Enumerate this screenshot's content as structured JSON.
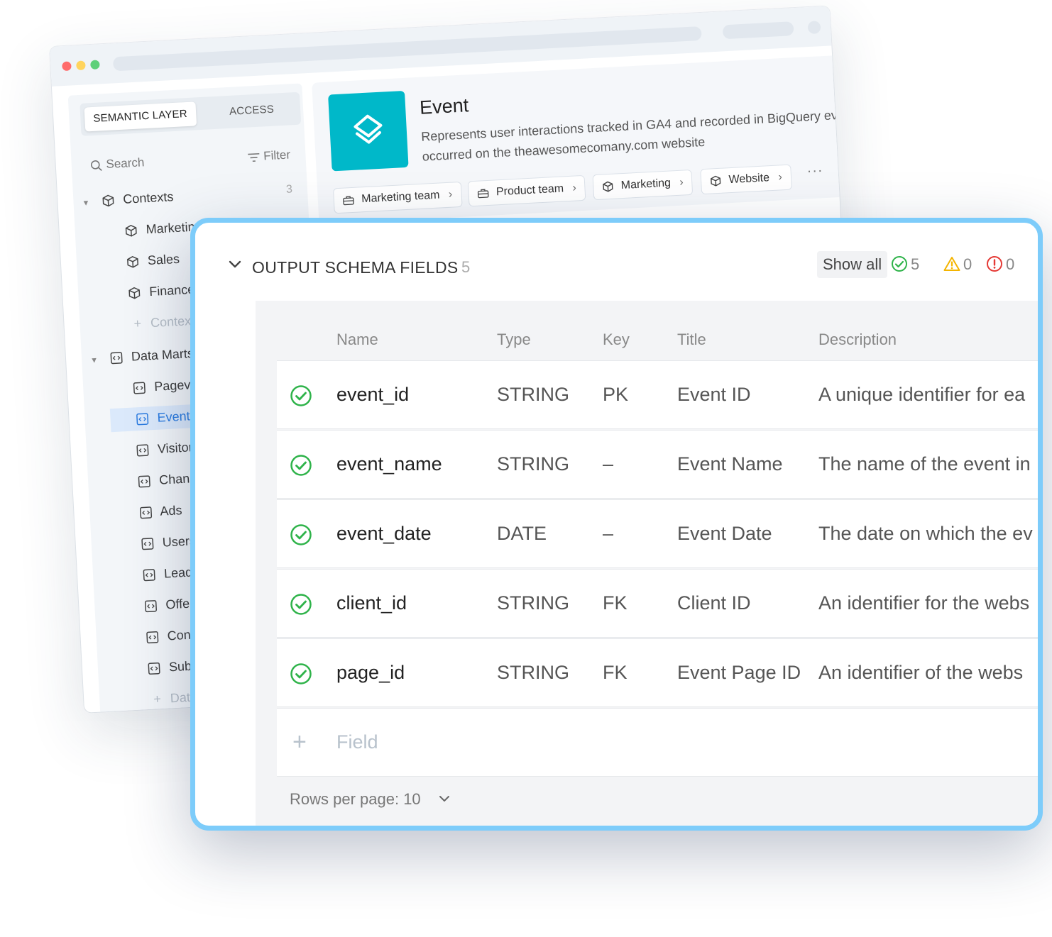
{
  "sidebar": {
    "tabs": [
      "SEMANTIC LAYER",
      "ACCESS"
    ],
    "search_placeholder": "Search",
    "filter_label": "Filter",
    "contexts": {
      "label": "Contexts",
      "count": "3",
      "items": [
        "Marketing",
        "Sales",
        "Finance"
      ],
      "add_label": "Context"
    },
    "data_marts": {
      "label": "Data Marts",
      "items": [
        "Pagevi",
        "Event",
        "Visitor",
        "Chann",
        "Ads",
        "Users",
        "Lead",
        "Offer",
        "Con",
        "Sub"
      ],
      "selected": "Event",
      "add_label": "Dat"
    }
  },
  "entity": {
    "title": "Event",
    "description": "Represents user interactions tracked in GA4 and recorded in BigQuery event occurred on the theawesomecomany.com website",
    "tags": [
      {
        "label": "Marketing team",
        "icon": "briefcase-icon"
      },
      {
        "label": "Product team",
        "icon": "briefcase-icon"
      },
      {
        "label": "Marketing",
        "icon": "cube-icon"
      },
      {
        "label": "Website",
        "icon": "cube-icon"
      }
    ],
    "more_label": "···"
  },
  "schema": {
    "title": "OUTPUT SCHEMA FIELDS",
    "count": "5",
    "show_all_label": "Show all",
    "stats": {
      "ok": "5",
      "warning": "0",
      "error": "0"
    },
    "columns": [
      "Name",
      "Type",
      "Key",
      "Title",
      "Description"
    ],
    "rows": [
      {
        "name": "event_id",
        "type": "STRING",
        "key": "PK",
        "title": "Event ID",
        "description": "A unique identifier for ea"
      },
      {
        "name": "event_name",
        "type": "STRING",
        "key": "–",
        "title": "Event Name",
        "description": "The name of the event in"
      },
      {
        "name": "event_date",
        "type": "DATE",
        "key": "–",
        "title": "Event Date",
        "description": "The date on which the ev"
      },
      {
        "name": "client_id",
        "type": "STRING",
        "key": "FK",
        "title": "Client ID",
        "description": "An identifier for the webs"
      },
      {
        "name": "page_id",
        "type": "STRING",
        "key": "FK",
        "title": "Event Page ID",
        "description": "An identifier of the webs"
      }
    ],
    "add_field_label": "Field",
    "rows_per_page_label": "Rows per page: 10"
  },
  "colors": {
    "accent": "#7dccfa",
    "tile": "#00b8c9",
    "ok": "#2fb34a",
    "warning": "#f4b400",
    "error": "#e53935"
  }
}
